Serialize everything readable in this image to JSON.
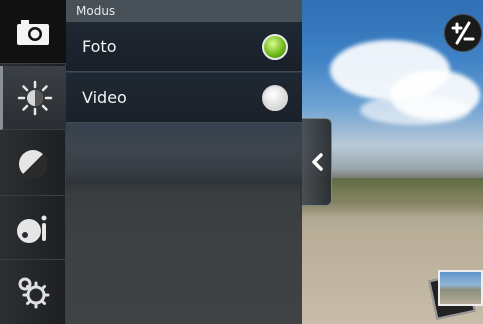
{
  "panel": {
    "title": "Modus",
    "options": [
      {
        "label": "Foto",
        "selected": true
      },
      {
        "label": "Video",
        "selected": false
      }
    ]
  },
  "mode_bar": {
    "items": [
      {
        "icon": "camera-icon"
      },
      {
        "icon": "white-balance-icon"
      },
      {
        "icon": "color-effect-icon"
      },
      {
        "icon": "scene-mode-icon"
      },
      {
        "icon": "settings-gear-icon"
      }
    ]
  },
  "colors": {
    "accent_selected": "#6bb316",
    "panel_bg": "#222830"
  },
  "controls": {
    "exposure_icon": "exposure-plus-minus-icon",
    "collapse_icon": "chevron-left-icon",
    "gallery_icon": "gallery-thumbnail-icon"
  }
}
